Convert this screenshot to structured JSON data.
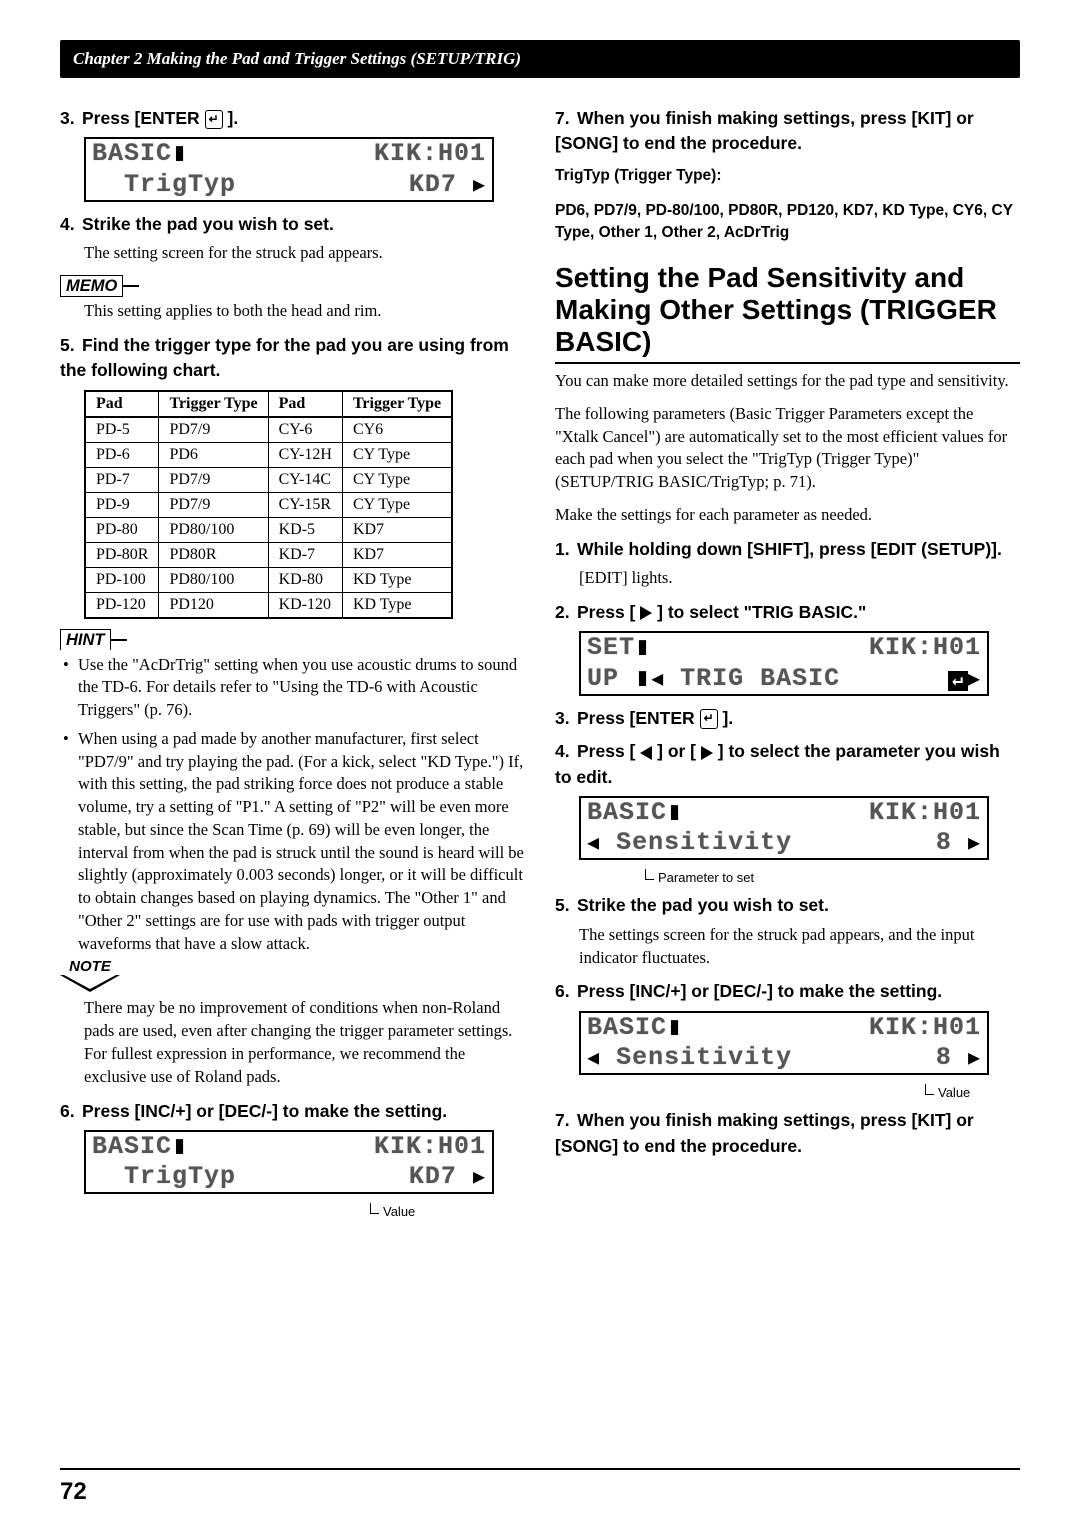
{
  "header": "Chapter 2 Making the Pad and Trigger Settings (SETUP/TRIG)",
  "page_num": "72",
  "L": {
    "s3": {
      "num": "3.",
      "t": "Press [ENTER",
      "t2": "]."
    },
    "lcd1": {
      "a": "BASIC",
      "b": "KIK:H01",
      "c": "TrigTyp",
      "d": "KD7"
    },
    "s4": {
      "num": "4.",
      "t": "Strike the pad you wish to set."
    },
    "s4b": "The setting screen for the struck pad appears.",
    "memo_lbl": "MEMO",
    "memo_t": "This setting applies to both the head and rim.",
    "s5": {
      "num": "5.",
      "t": "Find the trigger type for the pad you are using from the following chart."
    },
    "th": [
      "Pad",
      "Trigger Type",
      "Pad",
      "Trigger Type"
    ],
    "rows": [
      [
        "PD-5",
        "PD7/9",
        "CY-6",
        "CY6"
      ],
      [
        "PD-6",
        "PD6",
        "CY-12H",
        "CY Type"
      ],
      [
        "PD-7",
        "PD7/9",
        "CY-14C",
        "CY Type"
      ],
      [
        "PD-9",
        "PD7/9",
        "CY-15R",
        "CY Type"
      ],
      [
        "PD-80",
        "PD80/100",
        "KD-5",
        "KD7"
      ],
      [
        "PD-80R",
        "PD80R",
        "KD-7",
        "KD7"
      ],
      [
        "PD-100",
        "PD80/100",
        "KD-80",
        "KD Type"
      ],
      [
        "PD-120",
        "PD120",
        "KD-120",
        "KD Type"
      ]
    ],
    "hint_lbl": "HINT",
    "bul": [
      "Use the \"AcDrTrig\" setting when you use acoustic drums to sound the TD-6. For details refer to \"Using the TD-6 with Acoustic Triggers\" (p. 76).",
      "When using a pad made by another manufacturer, first select \"PD7/9\" and try playing the pad. (For a kick, select \"KD Type.\") If, with this setting, the pad striking force does not produce a stable volume, try a setting of \"P1.\" A setting of \"P2\" will be even more stable, but since the Scan Time (p. 69) will be even longer, the interval from when the pad is struck until the sound is heard will be slightly (approximately 0.003 seconds) longer, or it will be difficult to obtain changes based on playing dynamics. The \"Other 1\" and \"Other 2\" settings are for use with pads with trigger output waveforms that have a slow attack."
    ],
    "note_lbl": "NOTE",
    "note_t": "There may be no improvement of conditions when non-Roland pads are used, even after changing the trigger parameter settings. For fullest expression in performance, we recommend the exclusive use of Roland pads.",
    "s6": {
      "num": "6.",
      "t": "Press [INC/+] or [DEC/-] to make the setting."
    },
    "lcd2": {
      "a": "BASIC",
      "b": "KIK:H01",
      "c": "TrigTyp",
      "d": "KD7"
    },
    "ann_val": "Value"
  },
  "R": {
    "s7": {
      "num": "7.",
      "t": "When you finish making settings, press [KIT] or [SONG] to end the procedure."
    },
    "trigtyp_lbl": "TrigTyp (Trigger Type):",
    "trigtyp_vals": "PD6, PD7/9, PD-80/100, PD80R, PD120, KD7, KD Type, CY6, CY Type, Other 1, Other 2, AcDrTrig",
    "h2": "Setting the Pad Sensitivity and Making Other Settings (TRIGGER BASIC)",
    "intro1": "You can make more detailed settings for the pad type and sensitivity.",
    "intro2": "The following parameters (Basic Trigger Parameters except the \"Xtalk Cancel\") are automatically set to the most efficient values for each pad when you select the \"TrigTyp (Trigger Type)\" (SETUP/TRIG BASIC/TrigTyp; p. 71).",
    "intro3": "Make the settings for each parameter as needed.",
    "s1": {
      "num": "1.",
      "t": "While holding down [SHIFT], press [EDIT (SETUP)]."
    },
    "s1b": "[EDIT] lights.",
    "s2": {
      "num": "2.",
      "t": "Press [",
      "t2": "] to select \"TRIG BASIC.\""
    },
    "lcd1": {
      "a": "SET",
      "b": "KIK:H01",
      "c": "UP",
      "d": "TRIG BASIC"
    },
    "s3": {
      "num": "3.",
      "t": "Press [ENTER",
      "t2": "]."
    },
    "s4": {
      "num": "4.",
      "t": "Press [",
      "t2": "] or [",
      "t3": "] to select the parameter you wish to edit."
    },
    "lcd2": {
      "a": "BASIC",
      "b": "KIK:H01",
      "c": "Sensitivity",
      "d": "8"
    },
    "ann_param": "Parameter to set",
    "s5": {
      "num": "5.",
      "t": "Strike the pad you wish to set."
    },
    "s5b": "The settings screen for the struck pad appears, and the input indicator fluctuates.",
    "s6": {
      "num": "6.",
      "t": "Press [INC/+] or [DEC/-] to make the setting."
    },
    "lcd3": {
      "a": "BASIC",
      "b": "KIK:H01",
      "c": "Sensitivity",
      "d": "8"
    },
    "ann_val": "Value",
    "s7b": {
      "num": "7.",
      "t": "When you finish making settings, press [KIT] or [SONG] to end the procedure."
    }
  }
}
